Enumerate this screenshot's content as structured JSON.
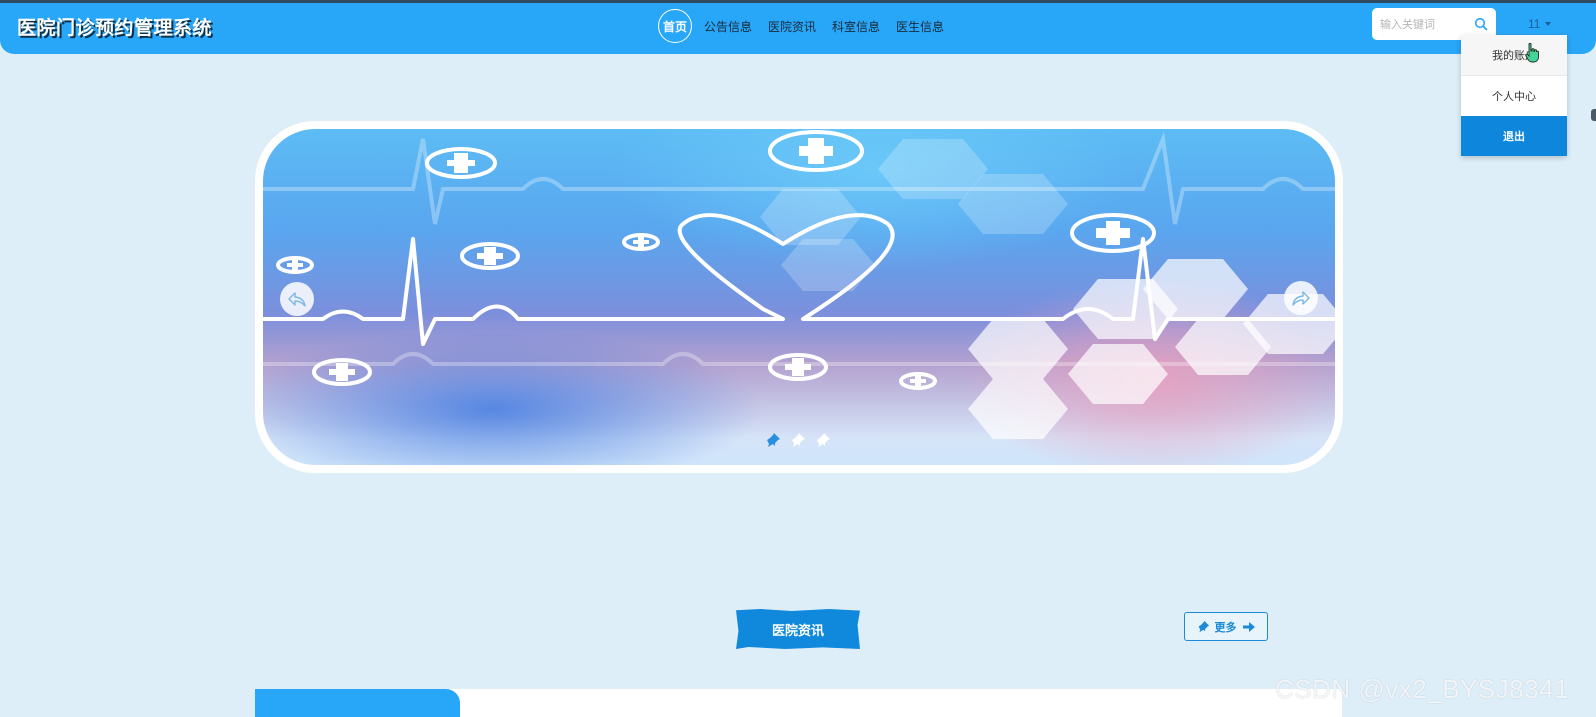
{
  "header": {
    "site_title": "医院门诊预约管理系统",
    "nav": [
      {
        "label": "首页",
        "active": true
      },
      {
        "label": "公告信息",
        "active": false
      },
      {
        "label": "医院资讯",
        "active": false
      },
      {
        "label": "科室信息",
        "active": false
      },
      {
        "label": "医生信息",
        "active": false
      }
    ],
    "search": {
      "placeholder": "输入关键词",
      "value": ""
    },
    "user": {
      "name": "11",
      "menu": [
        {
          "label": "我的账户"
        },
        {
          "label": "个人中心"
        },
        {
          "label": "退出"
        }
      ]
    }
  },
  "banner": {
    "slide_count": 3,
    "active_slide": 0,
    "colors": {
      "top": "#5dbcf4",
      "middle": "#7c8fdc",
      "pink": "#eca0be",
      "bottom": "#cfe5fb"
    }
  },
  "news_section": {
    "title": "医院资讯",
    "more_label": "更多"
  },
  "watermark": "CSDN @vx2_BYSJ8341",
  "colors": {
    "navbar": "#28a6f8",
    "page_background": "#deeef8",
    "primary_button": "#0d86dc",
    "title_shadow": "#0c2f4a"
  }
}
